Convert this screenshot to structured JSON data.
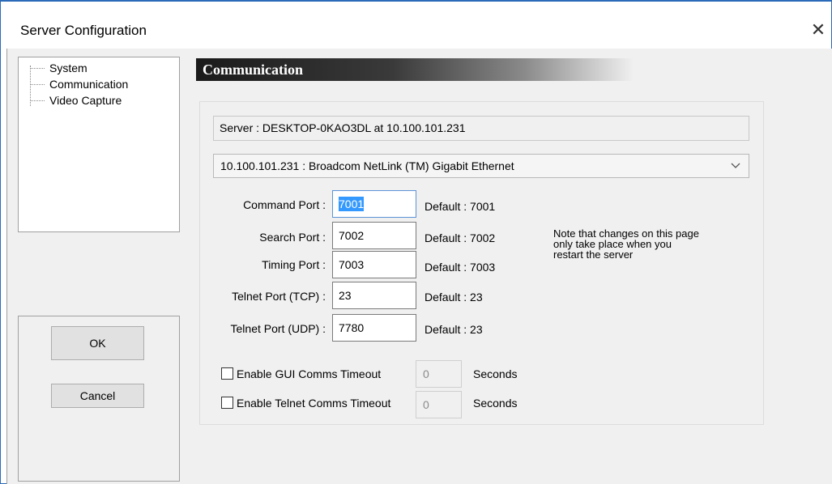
{
  "window": {
    "title": "Server Configuration",
    "close_glyph": "✕"
  },
  "tree": {
    "items": [
      {
        "label": "System",
        "selected": false
      },
      {
        "label": "Communication",
        "selected": true
      },
      {
        "label": "Video Capture",
        "selected": false
      }
    ]
  },
  "buttons": {
    "ok_label": "OK",
    "cancel_label": "Cancel"
  },
  "section": {
    "header": "Communication"
  },
  "server": {
    "info": "Server : DESKTOP-0KAO3DL  at  10.100.101.231"
  },
  "adapter": {
    "selected": "10.100.101.231 : Broadcom NetLink (TM) Gigabit Ethernet"
  },
  "ports": [
    {
      "label": "Command Port :",
      "value": "7001",
      "default": "Default : 7001"
    },
    {
      "label": "Search Port :",
      "value": "7002",
      "default": "Default : 7002"
    },
    {
      "label": "Timing Port :",
      "value": "7003",
      "default": "Default : 7003"
    },
    {
      "label": "Telnet Port (TCP) :",
      "value": "23",
      "default": "Default : 23"
    },
    {
      "label": "Telnet Port (UDP) :",
      "value": "7780",
      "default": "Default : 23"
    }
  ],
  "note": {
    "line1": "Note that changes on this page",
    "line2": "only take place when you",
    "line3": "restart the server"
  },
  "timeouts": [
    {
      "label": "Enable GUI Comms Timeout",
      "value": "0",
      "unit": "Seconds",
      "checked": false
    },
    {
      "label": "Enable Telnet Comms Timeout",
      "value": "0",
      "unit": "Seconds",
      "checked": false
    }
  ],
  "colors": {
    "accent": "#2a6ab8",
    "selection": "#3399ff"
  }
}
